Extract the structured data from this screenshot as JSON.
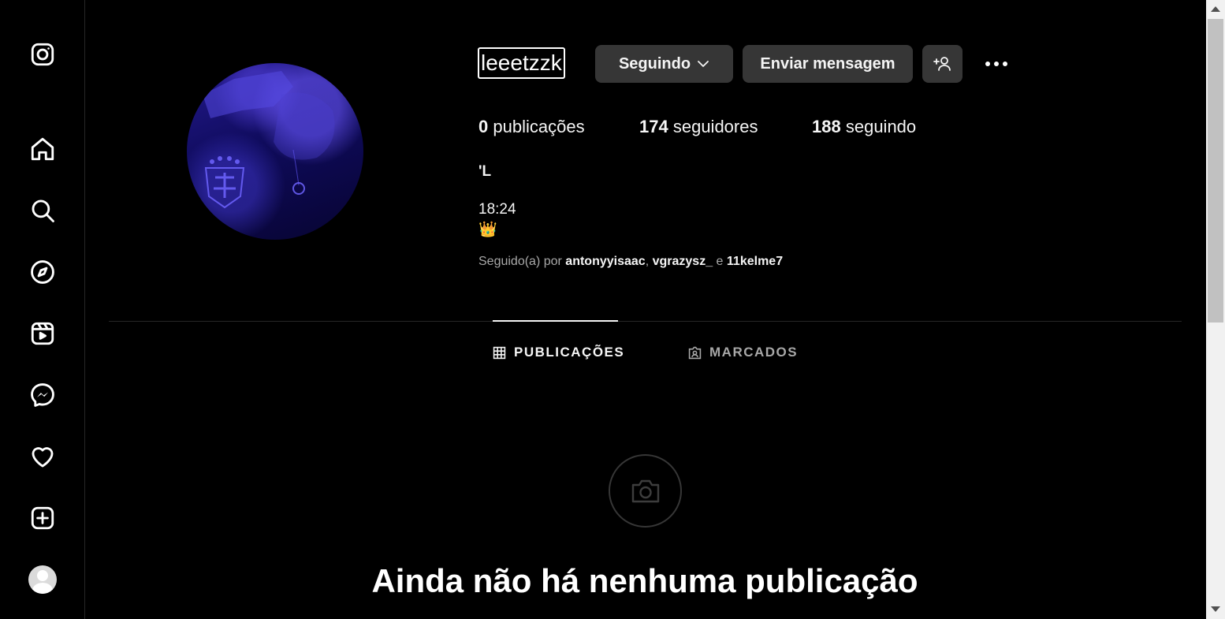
{
  "sidebar": {
    "icons": [
      "instagram-logo-icon",
      "home-icon",
      "search-icon",
      "explore-compass-icon",
      "reels-icon",
      "messenger-icon",
      "heart-icon",
      "create-plus-icon",
      "profile-avatar"
    ]
  },
  "profile": {
    "username": "leeetzzk",
    "follow_button_label": "Seguindo",
    "message_button_label": "Enviar mensagem",
    "stats": {
      "posts_count": "0",
      "posts_label": "publicações",
      "followers_count": "174",
      "followers_label": "seguidores",
      "following_count": "188",
      "following_label": "seguindo"
    },
    "full_name": "'L",
    "bio_line_1": "18:24",
    "bio_line_2": "👑",
    "followed_by_prefix": "Seguido(a) por",
    "followed_by_accounts": [
      "antonyyisaac",
      "vgrazysz_",
      "11kelme7"
    ],
    "followed_by_sep": ",",
    "followed_by_and": "e"
  },
  "tabs": [
    {
      "label": "PUBLICAÇÕES",
      "icon": "grid-icon",
      "active": true
    },
    {
      "label": "MARCADOS",
      "icon": "tagged-icon",
      "active": false
    }
  ],
  "empty_state": {
    "icon": "camera-icon",
    "title": "Ainda não há nenhuma publicação"
  },
  "colors": {
    "background": "#000000",
    "button_bg": "#363636",
    "muted_text": "#a8a8a8"
  }
}
